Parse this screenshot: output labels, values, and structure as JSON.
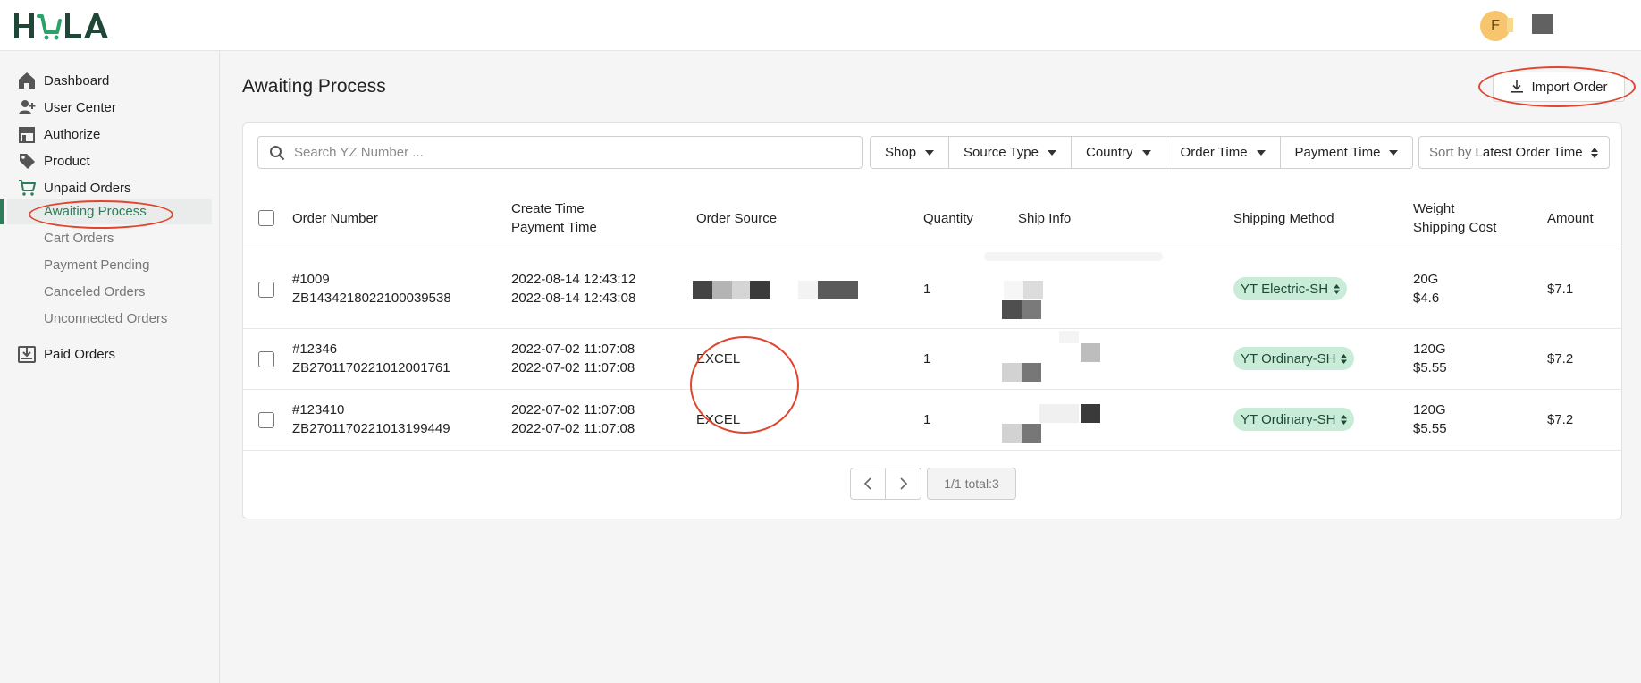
{
  "header": {
    "logo_text": "HOLA",
    "avatar_initial": "F"
  },
  "sidebar": {
    "items": [
      {
        "label": "Dashboard",
        "icon": "home-icon"
      },
      {
        "label": "User Center",
        "icon": "user-plus-icon"
      },
      {
        "label": "Authorize",
        "icon": "store-icon"
      },
      {
        "label": "Product",
        "icon": "tag-icon"
      },
      {
        "label": "Unpaid Orders",
        "icon": "cart-icon"
      },
      {
        "label": "Paid Orders",
        "icon": "download-box-icon"
      }
    ],
    "sub_items": [
      {
        "label": "Awaiting Process",
        "active": true
      },
      {
        "label": "Cart Orders"
      },
      {
        "label": "Payment Pending"
      },
      {
        "label": "Canceled Orders"
      },
      {
        "label": "Unconnected Orders"
      }
    ]
  },
  "main": {
    "title": "Awaiting Process",
    "import_label": "Import Order",
    "search_placeholder": "Search YZ Number ...",
    "filters": [
      "Shop",
      "Source Type",
      "Country",
      "Order Time",
      "Payment Time"
    ],
    "sort_prefix": "Sort by",
    "sort_value": "Latest Order Time",
    "columns": {
      "order_number": "Order Number",
      "create_time": "Create Time",
      "payment_time": "Payment Time",
      "order_source": "Order Source",
      "quantity": "Quantity",
      "ship_info": "Ship Info",
      "shipping_method": "Shipping Method",
      "weight": "Weight",
      "shipping_cost": "Shipping Cost",
      "amount": "Amount"
    },
    "rows": [
      {
        "number": "#1009",
        "code": "ZB1434218022100039538",
        "create": "2022-08-14 12:43:12",
        "payment": "2022-08-14 12:43:08",
        "source": "",
        "quantity": "1",
        "ship_info": "",
        "method": "YT Electric-SH",
        "weight": "20G",
        "cost": "$4.6",
        "amount": "$7.1"
      },
      {
        "number": "#12346",
        "code": "ZB2701170221012001761",
        "create": "2022-07-02 11:07:08",
        "payment": "2022-07-02 11:07:08",
        "source": "EXCEL",
        "quantity": "1",
        "ship_info": "",
        "method": "YT Ordinary-SH",
        "weight": "120G",
        "cost": "$5.55",
        "amount": "$7.2"
      },
      {
        "number": "#123410",
        "code": "ZB2701170221013199449",
        "create": "2022-07-02 11:07:08",
        "payment": "2022-07-02 11:07:08",
        "source": "EXCEL",
        "quantity": "1",
        "ship_info": "",
        "method": "YT Ordinary-SH",
        "weight": "120G",
        "cost": "$5.55",
        "amount": "$7.2"
      }
    ],
    "pagination": "1/1 total:3"
  },
  "colors": {
    "accent": "#2d7d5a",
    "pill_bg": "#c9ecd8",
    "annotation_red": "#e0452f",
    "logo": "#1f4637"
  }
}
